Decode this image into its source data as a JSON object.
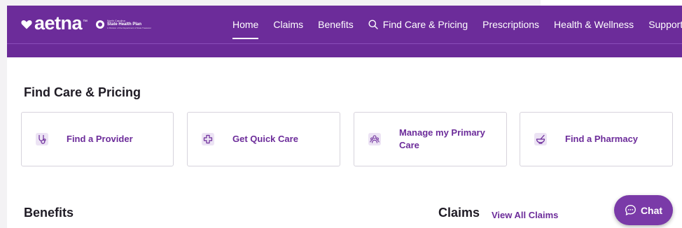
{
  "header": {
    "logo_text": "aetna",
    "logo_tm": "™",
    "cobrand": {
      "line1": "North Carolina",
      "line2": "State Health Plan",
      "line3": "A Division of the Department of State Treasurer"
    },
    "nav": [
      {
        "label": "Home",
        "active": true
      },
      {
        "label": "Claims",
        "active": false
      },
      {
        "label": "Benefits",
        "active": false
      },
      {
        "label": "Find Care & Pricing",
        "active": false,
        "icon": "search-icon"
      },
      {
        "label": "Prescriptions",
        "active": false
      },
      {
        "label": "Health & Wellness",
        "active": false
      },
      {
        "label": "Support",
        "active": false
      }
    ]
  },
  "find_care": {
    "title": "Find Care & Pricing",
    "cards": [
      {
        "label": "Find a Provider",
        "icon": "stethoscope-icon"
      },
      {
        "label": "Get Quick Care",
        "icon": "medical-cross-icon"
      },
      {
        "label": "Manage my Primary Care",
        "icon": "people-icon"
      },
      {
        "label": "Find a Pharmacy",
        "icon": "mortar-pestle-icon"
      }
    ]
  },
  "benefits": {
    "title": "Benefits"
  },
  "claims": {
    "title": "Claims",
    "view_all": "View All Claims"
  },
  "chat": {
    "label": "Chat",
    "icon": "chat-bubble-icon"
  },
  "colors": {
    "brand": "#6c2c9a",
    "icon_bg": "#ece3f4",
    "text": "#1f1b24"
  }
}
